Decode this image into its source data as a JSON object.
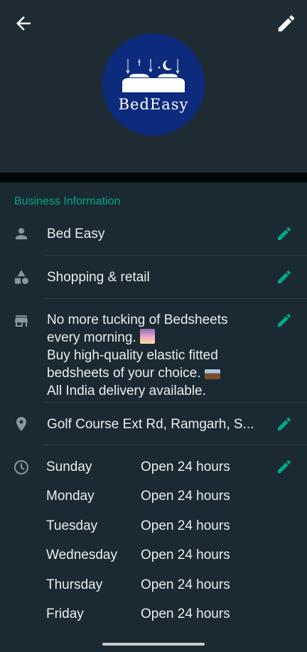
{
  "section": {
    "title": "Business Information"
  },
  "logo": {
    "text": "BedEasy"
  },
  "business": {
    "name": "Bed Easy",
    "category": "Shopping & retail",
    "description": [
      "No more tucking of Bedsheets",
      "every morning. ",
      "Buy high-quality elastic fitted",
      "bedsheets of your choice. ",
      "All India delivery available."
    ],
    "address": "Golf Course Ext Rd, Ramgarh, S..."
  },
  "hours": [
    {
      "day": "Sunday",
      "value": "Open 24 hours"
    },
    {
      "day": "Monday",
      "value": "Open 24 hours"
    },
    {
      "day": "Tuesday",
      "value": "Open 24 hours"
    },
    {
      "day": "Wednesday",
      "value": "Open 24 hours"
    },
    {
      "day": "Thursday",
      "value": "Open 24 hours"
    },
    {
      "day": "Friday",
      "value": "Open 24 hours"
    }
  ],
  "icons": {
    "back": "arrow-back-icon",
    "edit": "pencil-icon",
    "name": "person-icon",
    "category": "shapes-icon",
    "description": "storefront-icon",
    "address": "location-pin-icon",
    "hours": "clock-icon"
  },
  "colors": {
    "accent": "#00a884",
    "header_bg": "#1f2c34",
    "section_bg": "#1b2a32",
    "text": "#e9edef",
    "icon": "#8696a0",
    "logo_bg": "#0c2b7d"
  }
}
